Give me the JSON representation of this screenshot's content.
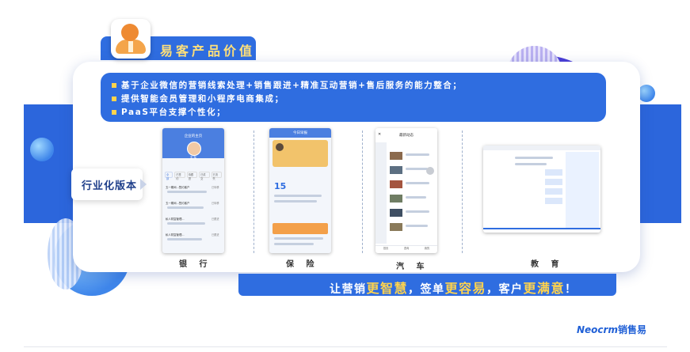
{
  "header": {
    "title": "易客产品价值"
  },
  "value_points": [
    "基于企业微信的营销线索处理+销售跟进+精准互动营销+售后服务的能力整合；",
    "提供智能会员管理和小程序电商集成；",
    "PaaS平台支撑个性化；"
  ],
  "industry": {
    "label": "行业化版本"
  },
  "screens": {
    "bank": {
      "label": "银 行",
      "nav_title": "企业的主页",
      "user_name": "王东",
      "tabs": [
        "全部",
        "已签约",
        "待跟进",
        "已成交",
        "已流失"
      ],
      "records": [
        "五一期间...签约客户",
        "五一期间...签约客户",
        "私人财富管理...",
        "私人财富管理..."
      ],
      "tags": [
        "已转移",
        "已转移",
        "已跟进",
        "已跟进"
      ]
    },
    "insurance": {
      "label": "保 险",
      "nav_title": "今日早报",
      "big_number": "15"
    },
    "auto": {
      "label": "汽 车",
      "nav_title": "最新动态",
      "nav_items": [
        "首页",
        "咨询",
        "我的"
      ]
    },
    "education": {
      "label": "教 育"
    }
  },
  "slogan": {
    "p1": "让营销",
    "h1": "更智慧",
    "p2": "，签单",
    "h2": "更容易",
    "p3": "，客户",
    "h3": "更满意",
    "p4": "！"
  },
  "brand": {
    "latin": "Neocrm",
    "cn": "销售易"
  },
  "colors": {
    "primary": "#2f6de0",
    "accent": "#ffd34d",
    "band": "#2c66dc",
    "purple": "#4a3dd6"
  }
}
